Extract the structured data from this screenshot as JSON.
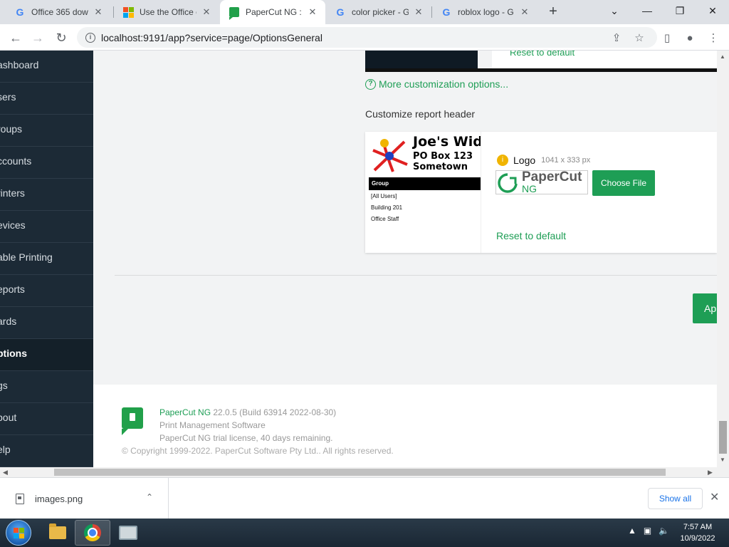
{
  "browser": {
    "tabs": [
      {
        "title": "Office 365 dow",
        "icon": "google-icon"
      },
      {
        "title": "Use the Office c",
        "icon": "microsoft-icon"
      },
      {
        "title": "PaperCut NG : C",
        "icon": "papercut-icon",
        "active": true
      },
      {
        "title": "color picker - G",
        "icon": "google-icon"
      },
      {
        "title": "roblox logo - G",
        "icon": "google-icon"
      }
    ],
    "url": "localhost:9191/app?service=page/OptionsGeneral"
  },
  "sidebar": {
    "items": [
      {
        "label": "ashboard"
      },
      {
        "label": "sers"
      },
      {
        "label": "roups"
      },
      {
        "label": "ccounts"
      },
      {
        "label": "rinters"
      },
      {
        "label": "evices"
      },
      {
        "label": "able Printing"
      },
      {
        "label": "eports"
      },
      {
        "label": "ards"
      },
      {
        "label": "ptions",
        "active": true
      },
      {
        "label": "gs"
      },
      {
        "label": "bout"
      },
      {
        "label": "elp"
      }
    ]
  },
  "main": {
    "top_reset": "Reset to default",
    "more_link": "More customization options...",
    "report_header_title": "Customize report header",
    "preview": {
      "line1": "Joe's Widg",
      "line2": "PO Box 123",
      "line3": "Sometown",
      "table_header": "Group",
      "rows": [
        "[All Users]",
        "Building 201",
        "Office Staff"
      ]
    },
    "logo": {
      "label": "Logo",
      "dimensions": "1041 x 333 px",
      "brand_main": "PaperCut",
      "brand_sub": "NG",
      "choose_file": "Choose File",
      "reset": "Reset to default"
    },
    "apply_label": "Ap"
  },
  "footer": {
    "product": "PaperCut NG",
    "version": "22.0.5 (Build 63914 2022-08-30)",
    "tagline": "Print Management Software",
    "license": "PaperCut NG trial license, 40 days remaining.",
    "copyright": "© Copyright 1999-2022. PaperCut Software Pty Ltd.. All rights reserved."
  },
  "downloads": {
    "file": "images.png",
    "show_all": "Show all"
  },
  "taskbar": {
    "time": "7:57 AM",
    "date": "10/9/2022"
  },
  "colors": {
    "brand_green": "#1e9e55",
    "sidebar_bg": "#1c2a36"
  }
}
